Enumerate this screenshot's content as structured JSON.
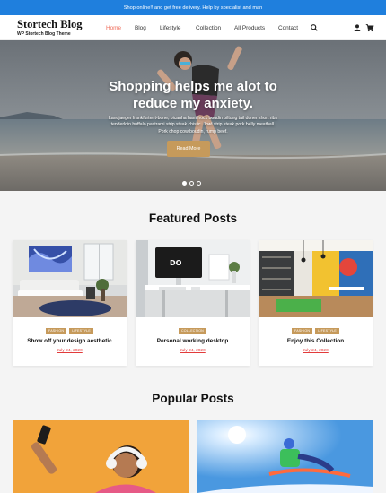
{
  "topbar": {
    "text": "Shop online!! and get free delivery. Help by specialist and man"
  },
  "brand": {
    "title": "Stortech Blog",
    "subtitle": "WP Stortech Blog Theme"
  },
  "nav": {
    "items": [
      "Home",
      "Blog",
      "Lifestyle",
      "Collection",
      "All Products",
      "Contact"
    ],
    "active_color": "#ef6c5a"
  },
  "icons": {
    "search": "search-icon",
    "user": "user-icon",
    "cart": "cart-icon"
  },
  "hero": {
    "title_line1": "Shopping helps me alot to",
    "title_line2": "reduce my anxiety.",
    "body_line1": "Landjaeger frankfurter t-bone, picanha ham hock boudin biltong tail doner short ribs",
    "body_line2": "tenderloin buffalo pastrami strip steak chislic. Jowl strip steak pork belly meatball.",
    "body_line3": "Pork chop cow boudin, rump beef.",
    "button": "Read More",
    "slides": 3,
    "active_slide": 1
  },
  "featured": {
    "title": "Featured Posts",
    "cards": [
      {
        "tags": [
          "FASHION",
          "LIFESTYLE"
        ],
        "title": "Show off your design aesthetic",
        "date": "July 24, 2020"
      },
      {
        "tags": [
          "COLLECTION"
        ],
        "title": "Personal working desktop",
        "date": "July 24, 2020"
      },
      {
        "tags": [
          "FASHION",
          "LIFESTYLE"
        ],
        "title": "Enjoy this Collection",
        "date": "July 24, 2020"
      }
    ]
  },
  "popular": {
    "title": "Popular Posts"
  },
  "colors": {
    "topbar": "#1f7fdd",
    "accent": "#c69a5b",
    "date": "#e23b3b",
    "nav_active": "#ef6c5a"
  }
}
